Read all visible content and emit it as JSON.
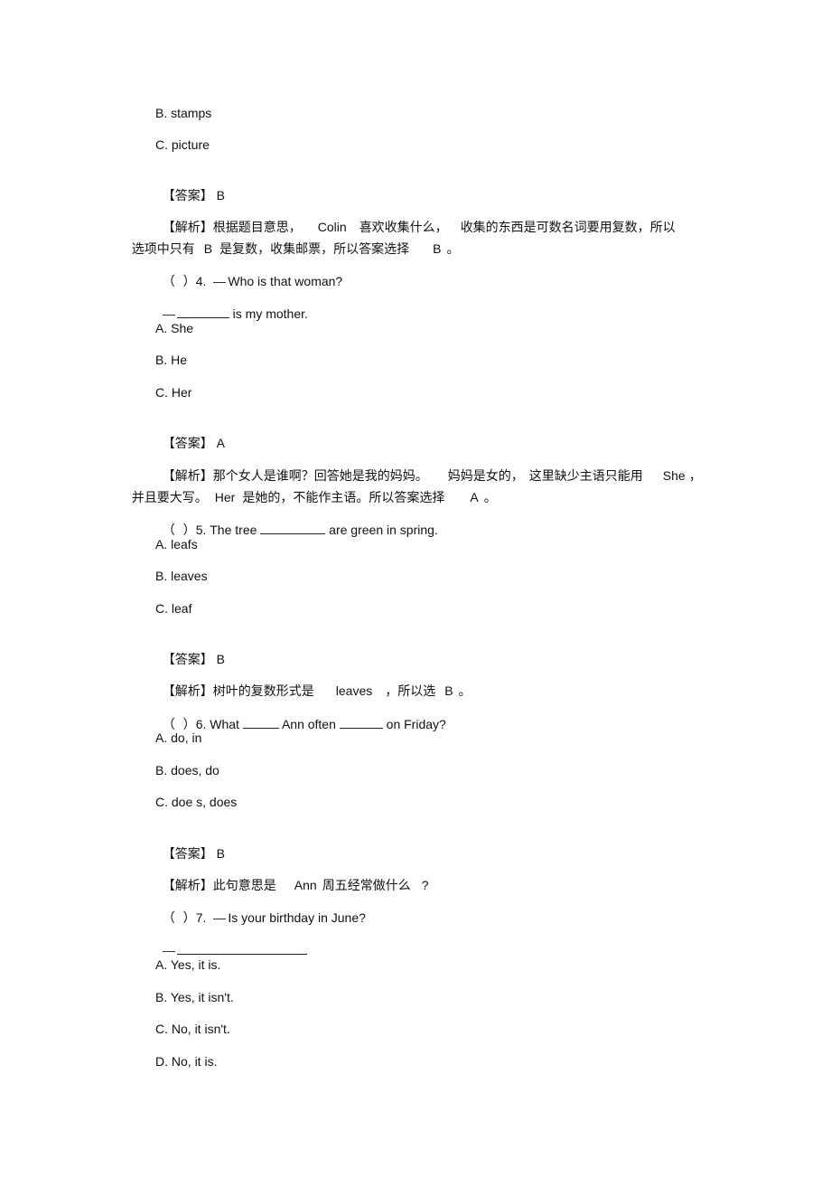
{
  "q3": {
    "options": [
      "B. stamps",
      "C. picture"
    ],
    "answer_label": "【答案】",
    "answer": "B",
    "analysis_label": "【解析】",
    "analysis_line1_a": "根据题目意思，",
    "analysis_line1_b": "Colin",
    "analysis_line1_c": "喜欢收集什么，",
    "analysis_line1_d": "收集的东西是可数名词要用复数，所以",
    "analysis_line2_a": "选项中只有",
    "analysis_line2_b": "B",
    "analysis_line2_c": "是复数，收集邮票，所以答案选择",
    "analysis_line2_d": "B",
    "analysis_line2_e": "。"
  },
  "q4": {
    "paren": "（  ）",
    "number": "4.",
    "question": "Who is that woman?",
    "response_suffix": " is my mother.",
    "options": [
      "A. She",
      "B. He",
      "C. Her"
    ],
    "answer_label": "【答案】",
    "answer": "A",
    "analysis_label": "【解析】",
    "analysis_line1_a": "那个女人是谁啊？回答她是我的妈妈。",
    "analysis_line1_b": "妈妈是女的，",
    "analysis_line1_c": "这里缺少主语只能用",
    "analysis_line1_d": "She",
    "analysis_line1_e": "，",
    "analysis_line2_a": "并且要大写。",
    "analysis_line2_b": "Her",
    "analysis_line2_c": "是她的，不能作主语。所以答案选择",
    "analysis_line2_d": "A",
    "analysis_line2_e": "。"
  },
  "q5": {
    "paren": "（  ）",
    "prefix": "5. The tree ",
    "suffix": " are green in spring.",
    "options": [
      "A. leafs",
      "B. leaves",
      "C. leaf"
    ],
    "answer_label": "【答案】",
    "answer": "B",
    "analysis_label": "【解析】",
    "analysis_a": "树叶的复数形式是",
    "analysis_b": "leaves",
    "analysis_c": "，所以选",
    "analysis_d": "B",
    "analysis_e": "。"
  },
  "q6": {
    "paren": "（  ）",
    "prefix": "6. What ",
    "middle": " Ann often ",
    "suffix": " on Friday?",
    "options": [
      "A. do, in",
      "B. does, do",
      "C. doe s, does"
    ],
    "answer_label": "【答案】",
    "answer": "B",
    "analysis_label": "【解析】",
    "analysis_a": "此句意思是",
    "analysis_b": "Ann",
    "analysis_c": "周五经常做什么",
    "analysis_d": "?"
  },
  "q7": {
    "paren": "（  ）",
    "number": "7.",
    "question": "Is your birthday in June?",
    "options": [
      "A. Yes, it is.",
      "B. Yes, it isn't.",
      "C. No, it isn't.",
      "D. No, it is."
    ]
  }
}
